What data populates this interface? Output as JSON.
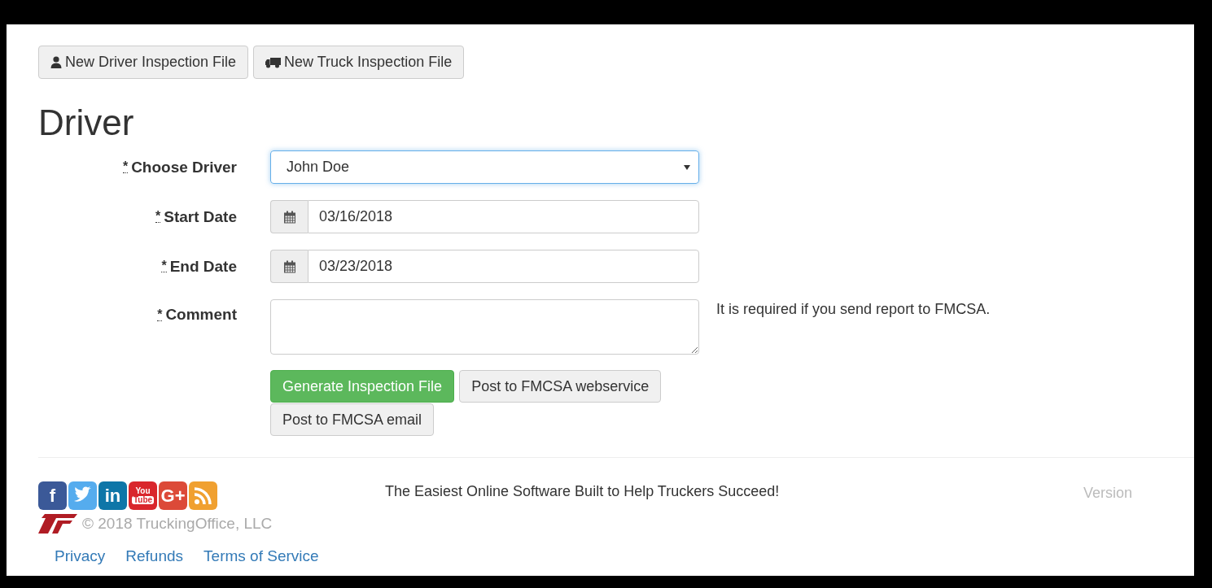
{
  "toolbar": [
    {
      "label": "New Driver Inspection File",
      "kind": "person"
    },
    {
      "label": "New Truck Inspection File",
      "kind": "truck"
    }
  ],
  "heading": "Driver",
  "form": [
    {
      "label": "Choose Driver",
      "required_mark": "*",
      "required": true,
      "kind": "select",
      "value": "John Doe",
      "focused": true
    },
    {
      "label": "Start Date",
      "required_mark": "*",
      "required": true,
      "kind": "date",
      "value": "03/16/2018"
    },
    {
      "label": "End Date",
      "required_mark": "*",
      "required": true,
      "kind": "date",
      "value": "03/23/2018"
    },
    {
      "label": "Comment",
      "required_mark": "*",
      "required": true,
      "kind": "textarea",
      "help": "It is required if you send report to FMCSA."
    }
  ],
  "actions": [
    {
      "label": "Generate Inspection File",
      "kind": "primary"
    },
    {
      "label": "Post to FMCSA webservice",
      "kind": "default"
    },
    {
      "label": "Post to FMCSA email",
      "kind": "default"
    }
  ],
  "footer": {
    "social": [
      {
        "kind": "text",
        "label": "f",
        "color": "#3b5998"
      },
      {
        "kind": "twitter",
        "color": "#55acee"
      },
      {
        "kind": "text",
        "label": "in",
        "color": "#0e76a8"
      },
      {
        "kind": "youtube",
        "label": "You",
        "label2": "Tube",
        "color": "#d9262c"
      },
      {
        "kind": "text",
        "label": "G+",
        "color": "#dc4a38"
      },
      {
        "kind": "rss",
        "color": "#f0a030"
      }
    ],
    "tagline": "The Easiest Online Software Built to Help Truckers Succeed!",
    "version": "Version",
    "copyright": "© 2018 TruckingOffice, LLC",
    "links": [
      "Privacy",
      "Refunds",
      "Terms of Service"
    ]
  }
}
